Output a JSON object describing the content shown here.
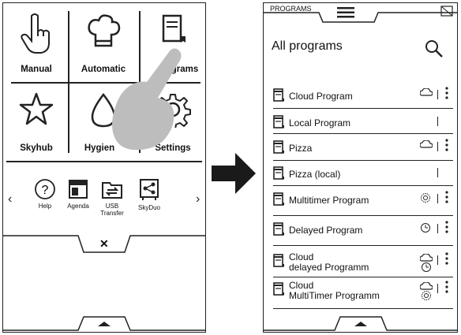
{
  "left": {
    "tiles": [
      {
        "label": "Manual"
      },
      {
        "label": "Automatic"
      },
      {
        "label": "grams"
      },
      {
        "label": "Skyhub"
      },
      {
        "label": "Hygien"
      },
      {
        "label": "Settings"
      }
    ],
    "shortcuts": [
      {
        "label": "Help"
      },
      {
        "label": "Agenda"
      },
      {
        "label": "USB\nTransfer"
      },
      {
        "label": "SkyDuo"
      }
    ],
    "prev_arrow": "‹",
    "next_arrow": "›",
    "close_label": "✕"
  },
  "right": {
    "tab_label": "PROGRAMS",
    "title": "All programs",
    "programs": [
      {
        "name": "Cloud Program",
        "status": "cloud"
      },
      {
        "name": "Local Program",
        "status": "none"
      },
      {
        "name": "Pizza",
        "status": "cloud"
      },
      {
        "name": "Pizza (local)",
        "status": "none"
      },
      {
        "name": "Multitimer Program",
        "status": "multitimer"
      },
      {
        "name": "Delayed Program",
        "status": "delayed"
      },
      {
        "name": "Cloud\ndelayed Programm",
        "status": "cloud-delayed"
      },
      {
        "name": "Cloud\nMultiTimer Programm",
        "status": "cloud-multitimer"
      }
    ]
  },
  "colors": {
    "line": "#222222",
    "hand": "#bdbdbd",
    "arrow": "#1a1a1a"
  }
}
